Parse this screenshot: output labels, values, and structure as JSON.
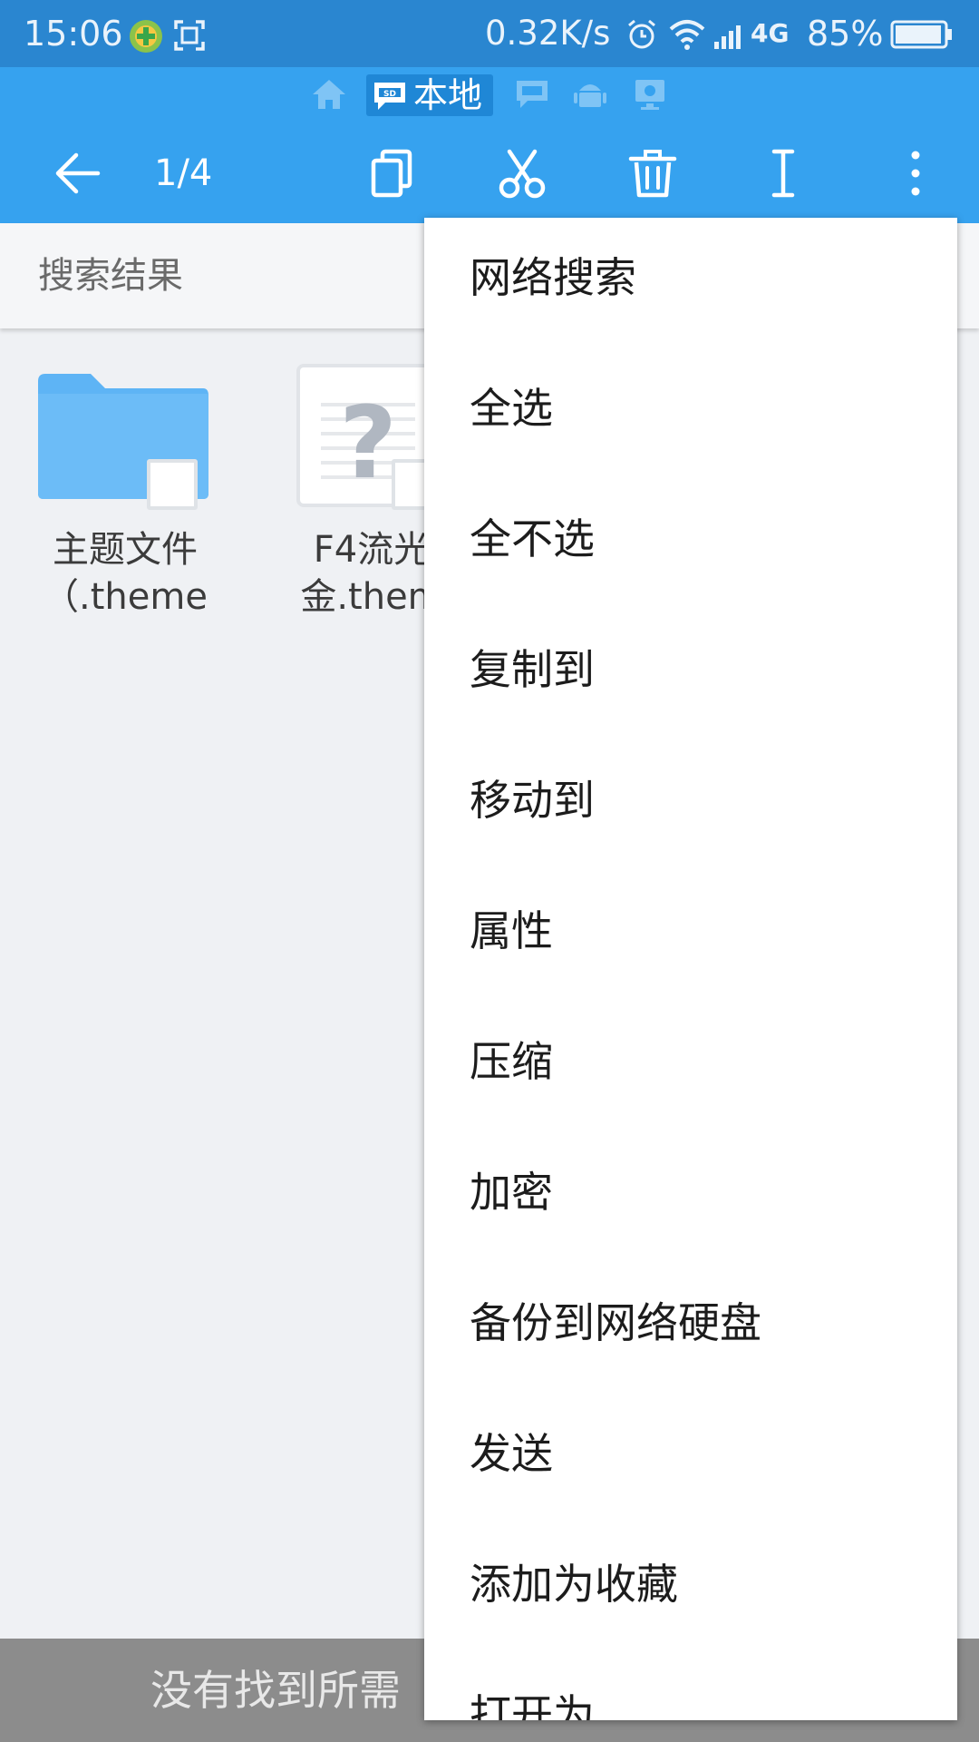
{
  "status_bar": {
    "time": "15:06",
    "network_speed": "0.32K/s",
    "network_type": "4G",
    "battery_percent": "85%",
    "icons": [
      "plus-badge-icon",
      "screenshot-icon",
      "alarm-icon",
      "wifi-icon",
      "signal-icon",
      "battery-icon"
    ]
  },
  "location_bar": {
    "active_label": "本地",
    "icons": [
      "home-icon",
      "sd-card-icon",
      "sd-card-icon",
      "android-icon",
      "remote-icon"
    ]
  },
  "toolbar": {
    "selection_count": "1/4",
    "icons": [
      "back-arrow-icon",
      "copy-icon",
      "cut-icon",
      "delete-icon",
      "rename-icon",
      "more-vert-icon"
    ]
  },
  "search_tab": {
    "label": "搜索结果"
  },
  "files": [
    {
      "name_line1": "主题文件",
      "name_line2": "（.theme",
      "icon": "folder-icon"
    },
    {
      "name_line1": "F4流光",
      "name_line2": "金.them",
      "icon": "unknown-file-icon"
    }
  ],
  "hint_bar": {
    "text": "没有找到所需"
  },
  "menu": {
    "items": [
      "网络搜索",
      "全选",
      "全不选",
      "复制到",
      "移动到",
      "属性",
      "压缩",
      "加密",
      "备份到网络硬盘",
      "发送",
      "添加为收藏",
      "打开为"
    ]
  },
  "colors": {
    "status_bar": "#2a86d0",
    "app_bar": "#36a2ef",
    "active_chip": "#1f87d6",
    "folder": "#5eb4f5",
    "background": "#eff1f4",
    "hint_bar": "#8c8c8c"
  }
}
